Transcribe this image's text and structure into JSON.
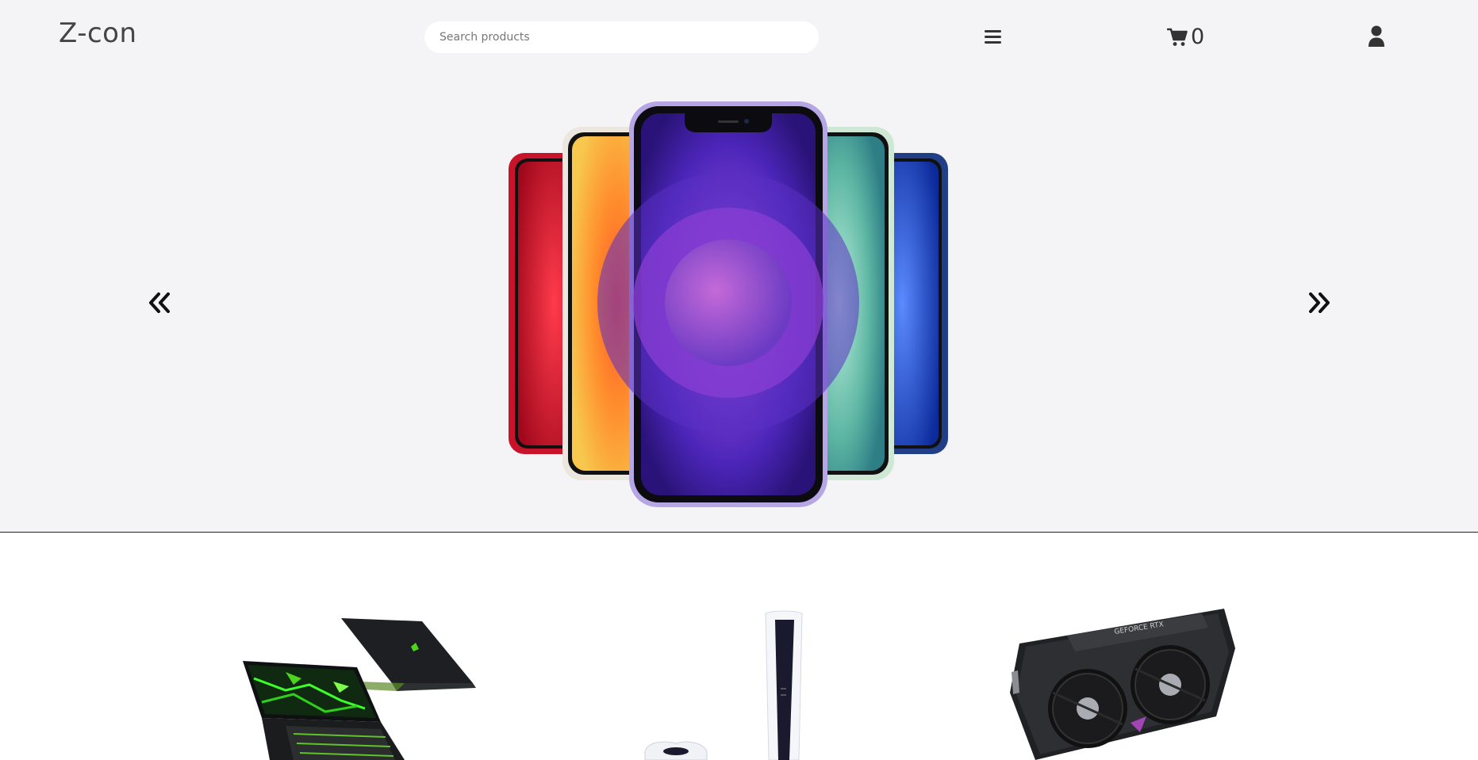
{
  "header": {
    "logo": "Z-con",
    "search": {
      "placeholder": "Search products",
      "value": ""
    },
    "menu_icon": "hamburger-menu-icon",
    "cart": {
      "icon": "shopping-cart-icon",
      "count": "0"
    },
    "account_icon": "user-icon"
  },
  "hero": {
    "prev_icon": "double-chevron-left-icon",
    "next_icon": "double-chevron-right-icon",
    "image": "iphone-12-color-lineup",
    "phone_colors": [
      "#c8132b",
      "#f3a233",
      "#7b4bd8",
      "#86cbb2",
      "#2553b8"
    ]
  },
  "products": [
    {
      "image": "gaming-laptop",
      "accent": "#4cd41f"
    },
    {
      "image": "game-console",
      "accent": "#1a1a2e"
    },
    {
      "image": "graphics-card",
      "accent": "#2a2a2a"
    }
  ],
  "colors": {
    "header_bg": "#f4f4f6",
    "page_bg": "#ffffff",
    "text": "#333333"
  }
}
